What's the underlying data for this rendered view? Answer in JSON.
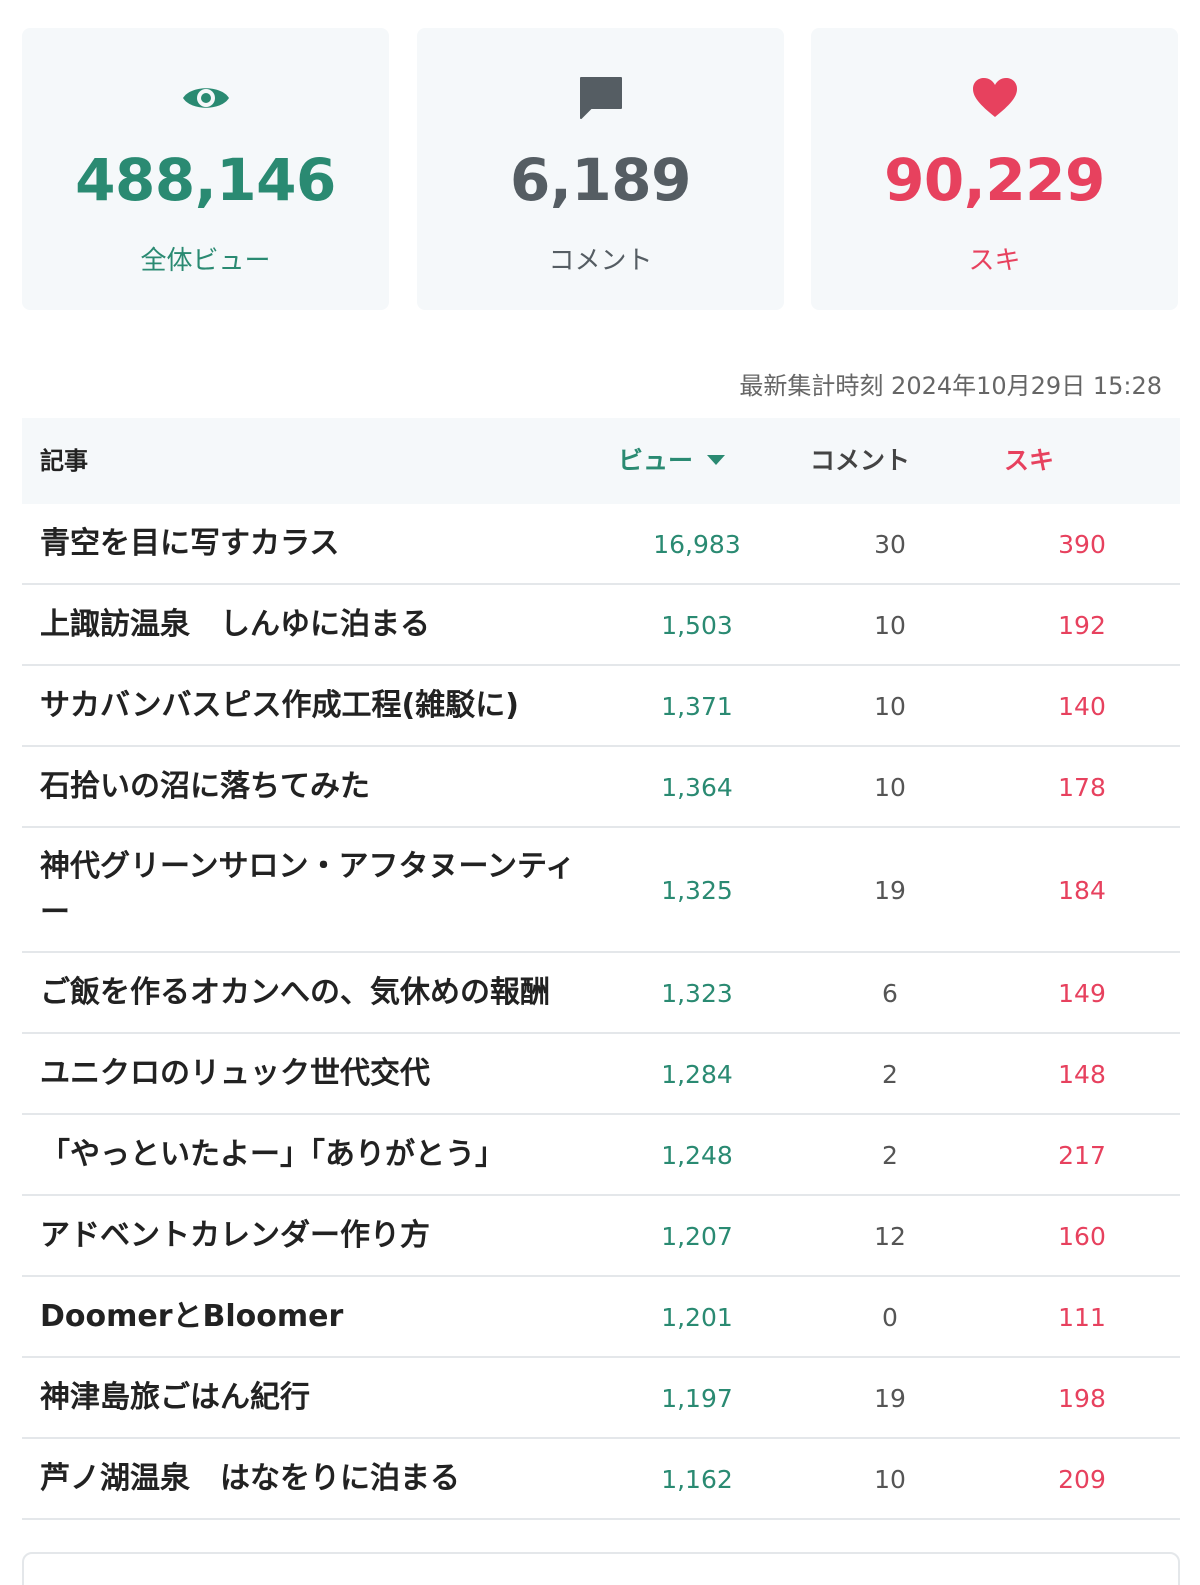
{
  "summary": {
    "views": {
      "value": "488,146",
      "label": "全体ビュー",
      "icon": "eye-icon",
      "color": "#2a8a72"
    },
    "comments": {
      "value": "6,189",
      "label": "コメント",
      "icon": "comment-icon",
      "color": "#555d63"
    },
    "likes": {
      "value": "90,229",
      "label": "スキ",
      "icon": "heart-icon",
      "color": "#e7415e"
    }
  },
  "timestamp": "最新集計時刻 2024年10月29日 15:28",
  "table": {
    "headers": {
      "article": "記事",
      "views": "ビュー",
      "comments": "コメント",
      "likes": "スキ"
    },
    "sort": {
      "column": "views",
      "direction": "descending"
    },
    "rows": [
      {
        "title": "青空を目に写すカラス",
        "views": "16,983",
        "comments": "30",
        "likes": "390"
      },
      {
        "title": "上諏訪温泉　しんゆに泊まる",
        "views": "1,503",
        "comments": "10",
        "likes": "192"
      },
      {
        "title": "サカバンバスピス作成工程(雑駁に)",
        "views": "1,371",
        "comments": "10",
        "likes": "140"
      },
      {
        "title": "石拾いの沼に落ちてみた",
        "views": "1,364",
        "comments": "10",
        "likes": "178"
      },
      {
        "title": "神代グリーンサロン・アフタヌーンティー",
        "views": "1,325",
        "comments": "19",
        "likes": "184"
      },
      {
        "title": "ご飯を作るオカンへの、気休めの報酬",
        "views": "1,323",
        "comments": "6",
        "likes": "149"
      },
      {
        "title": "ユニクロのリュック世代交代",
        "views": "1,284",
        "comments": "2",
        "likes": "148"
      },
      {
        "title": "「やっといたよー」「ありがとう」",
        "views": "1,248",
        "comments": "2",
        "likes": "217"
      },
      {
        "title": "アドベントカレンダー作り方",
        "views": "1,207",
        "comments": "12",
        "likes": "160"
      },
      {
        "title": "DoomerとBloomer",
        "views": "1,201",
        "comments": "0",
        "likes": "111"
      },
      {
        "title": "神津島旅ごはん紀行",
        "views": "1,197",
        "comments": "19",
        "likes": "198"
      },
      {
        "title": "芦ノ湖温泉　はなをりに泊まる",
        "views": "1,162",
        "comments": "10",
        "likes": "209"
      }
    ]
  }
}
